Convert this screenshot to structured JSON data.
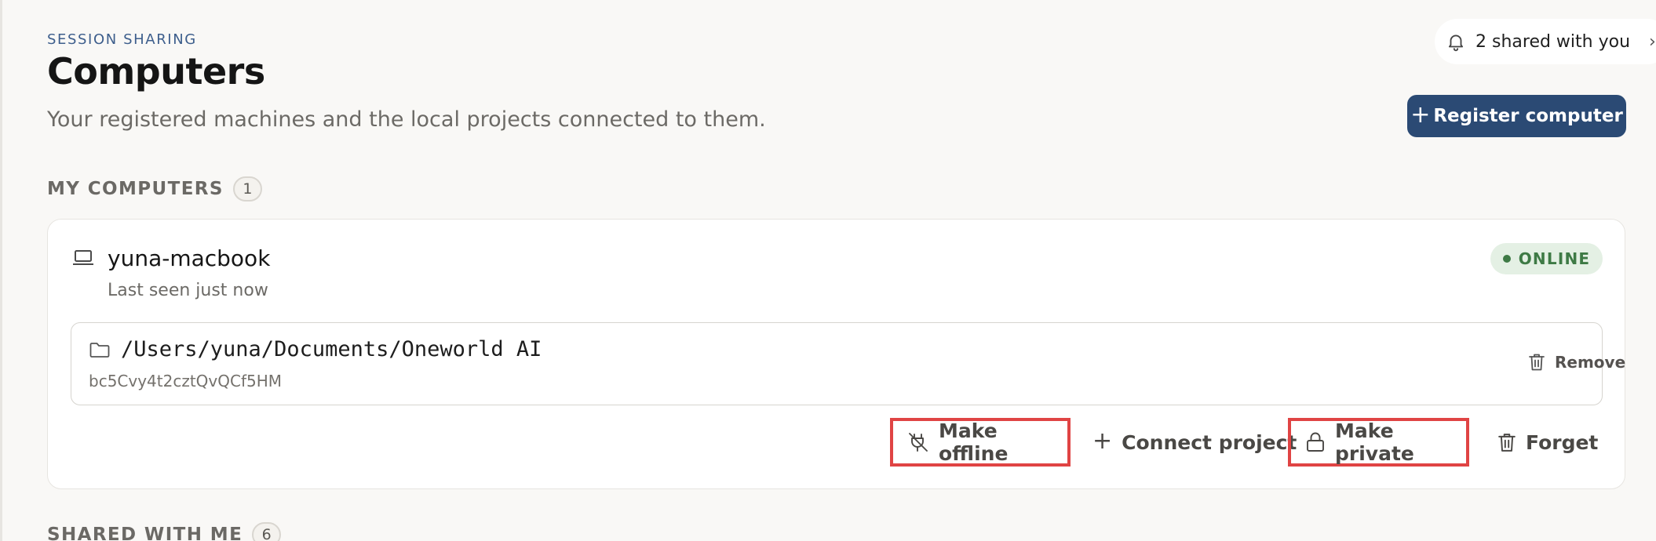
{
  "header": {
    "eyebrow": "SESSION SHARING",
    "title": "Computers",
    "subtitle": "Your registered machines and the local projects connected to them."
  },
  "shared_pill": {
    "icon": "bell-icon",
    "label": "2 shared with you"
  },
  "register_button": {
    "label": "Register computer",
    "accent": "#2b4a74"
  },
  "my_computers": {
    "label": "MY COMPUTERS",
    "count": "1",
    "computers": [
      {
        "name": "yuna-macbook",
        "last_seen": "Last seen just now",
        "status": "ONLINE",
        "status_color": "#3e7a45",
        "projects": [
          {
            "path": "/Users/yuna/Documents/Oneworld AI",
            "id": "bc5Cvy4t2cztQvQCf5HM",
            "remove_label": "Remove"
          }
        ],
        "actions": {
          "make_offline": "Make offline",
          "connect_project": "Connect project",
          "make_private": "Make private",
          "forget": "Forget"
        }
      }
    ]
  },
  "shared_with_me": {
    "label": "SHARED WITH ME",
    "count": "6"
  },
  "highlight_color": "#e04444"
}
